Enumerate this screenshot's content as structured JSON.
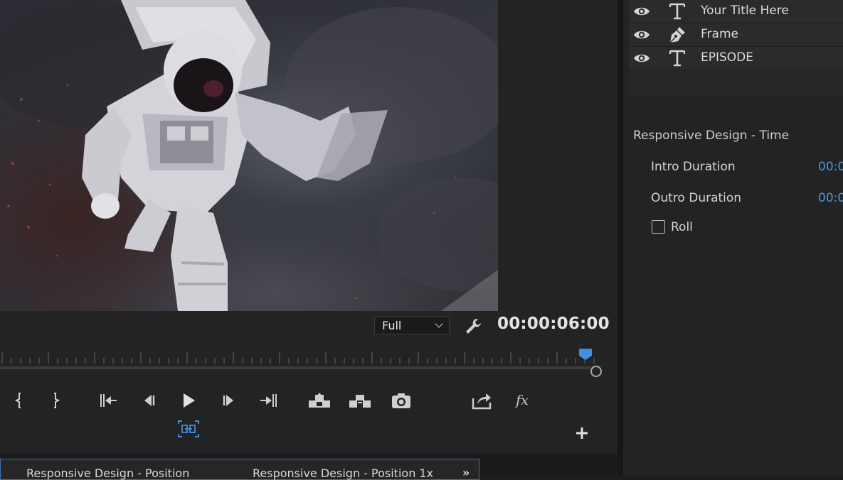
{
  "monitor": {
    "zoom_select": "Full",
    "timecode": "00:00:06:00",
    "playhead_fraction": 0.97
  },
  "transport": {
    "buttons": [
      {
        "name": "mark-in-icon"
      },
      {
        "name": "mark-out-icon"
      },
      {
        "name": "go-to-in-icon"
      },
      {
        "name": "step-back-icon"
      },
      {
        "name": "play-icon"
      },
      {
        "name": "step-forward-icon"
      },
      {
        "name": "go-to-out-icon"
      },
      {
        "name": "lift-icon"
      },
      {
        "name": "extract-icon"
      },
      {
        "name": "export-frame-icon"
      },
      {
        "name": "share-icon"
      },
      {
        "name": "fx-icon",
        "label": "fx"
      }
    ]
  },
  "bottom_tabs": {
    "tab1": "Responsive Design - Position",
    "tab2": "Responsive Design - Position 1x",
    "more": "»"
  },
  "layers": [
    {
      "name": "Your Title Here",
      "type": "text"
    },
    {
      "name": "Frame",
      "type": "shape"
    },
    {
      "name": "EPISODE",
      "type": "text"
    }
  ],
  "responsive_time": {
    "section_title": "Responsive Design - Time",
    "intro_label": "Intro Duration",
    "intro_value": "00:0",
    "outro_label": "Outro Duration",
    "outro_value": "00:0",
    "roll_label": "Roll",
    "roll_checked": false
  },
  "colors": {
    "accent_blue": "#3d9be9",
    "panel_bg": "#232323"
  }
}
